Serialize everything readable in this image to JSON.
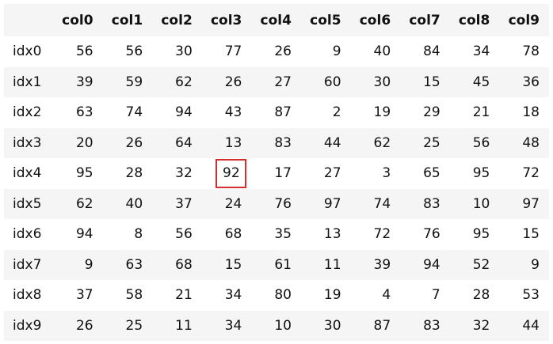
{
  "table": {
    "corner": "",
    "columns": [
      "col0",
      "col1",
      "col2",
      "col3",
      "col4",
      "col5",
      "col6",
      "col7",
      "col8",
      "col9"
    ],
    "rows": [
      {
        "index": "idx0",
        "values": [
          "56",
          "56",
          "30",
          "77",
          "26",
          "9",
          "40",
          "84",
          "34",
          "78"
        ]
      },
      {
        "index": "idx1",
        "values": [
          "39",
          "59",
          "62",
          "26",
          "27",
          "60",
          "30",
          "15",
          "45",
          "36"
        ]
      },
      {
        "index": "idx2",
        "values": [
          "63",
          "74",
          "94",
          "43",
          "87",
          "2",
          "19",
          "29",
          "21",
          "18"
        ]
      },
      {
        "index": "idx3",
        "values": [
          "20",
          "26",
          "64",
          "13",
          "83",
          "44",
          "62",
          "25",
          "56",
          "48"
        ]
      },
      {
        "index": "idx4",
        "values": [
          "95",
          "28",
          "32",
          "92",
          "17",
          "27",
          "3",
          "65",
          "95",
          "72"
        ]
      },
      {
        "index": "idx5",
        "values": [
          "62",
          "40",
          "37",
          "24",
          "76",
          "97",
          "74",
          "83",
          "10",
          "97"
        ]
      },
      {
        "index": "idx6",
        "values": [
          "94",
          "8",
          "56",
          "68",
          "35",
          "13",
          "72",
          "76",
          "95",
          "15"
        ]
      },
      {
        "index": "idx7",
        "values": [
          "9",
          "63",
          "68",
          "15",
          "61",
          "11",
          "39",
          "94",
          "52",
          "9"
        ]
      },
      {
        "index": "idx8",
        "values": [
          "37",
          "58",
          "21",
          "34",
          "80",
          "19",
          "4",
          "7",
          "28",
          "53"
        ]
      },
      {
        "index": "idx9",
        "values": [
          "26",
          "25",
          "11",
          "34",
          "10",
          "30",
          "87",
          "83",
          "32",
          "44"
        ]
      }
    ],
    "highlighted_cell": {
      "row": 4,
      "col": 3
    },
    "colors": {
      "striped_row": "#f5f5f5",
      "plain_row": "#ffffff",
      "highlight_border": "#d32f2f",
      "text": "#111111"
    }
  }
}
